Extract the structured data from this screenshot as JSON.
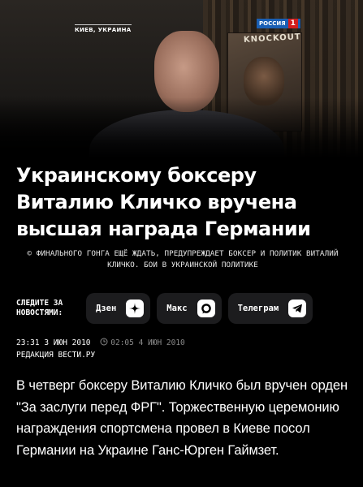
{
  "hero": {
    "location_caption": "КИЕВ, УКРАИНА",
    "channel_name": "РОССИЯ",
    "channel_number": "1",
    "poster_text": "KNOCKOUT"
  },
  "article": {
    "title": "Украинскому боксеру Виталию Кличко вручена высшая награда Германии",
    "lead": "© ФИНАЛЬНОГО ГОНГА ЕЩЁ ЖДАТЬ, ПРЕДУПРЕЖДАЕТ БОКСЕР И ПОЛИТИК ВИТАЛИЙ КЛИЧКО. БОИ В УКРАИНСКОЙ ПОЛИТИКЕ",
    "published": "23:31 3 ИЮН 2010",
    "updated": "02:05 4 ИЮН 2010",
    "source": "РЕДАКЦИЯ ВЕСТИ.РУ",
    "body": "В четверг боксеру Виталию Кличко был вручен орден \"За заслуги перед ФРГ\". Торжественную церемонию награждения спортсмена провел в Киеве посол Германии на Украине Ганс-Юрген Гаймзет."
  },
  "follow": {
    "label": "СЛЕДИТЕ ЗА НОВОСТЯМИ:",
    "links": [
      {
        "label": "Дзен",
        "icon": "dzen-icon"
      },
      {
        "label": "Макс",
        "icon": "max-icon"
      },
      {
        "label": "Телеграм",
        "icon": "telegram-icon"
      }
    ]
  },
  "colors": {
    "background": "#000000",
    "pill_background": "#1c1c1e",
    "muted": "#8a8a8a",
    "channel_blue": "#1a5fb4",
    "channel_red": "#d21e1e"
  }
}
